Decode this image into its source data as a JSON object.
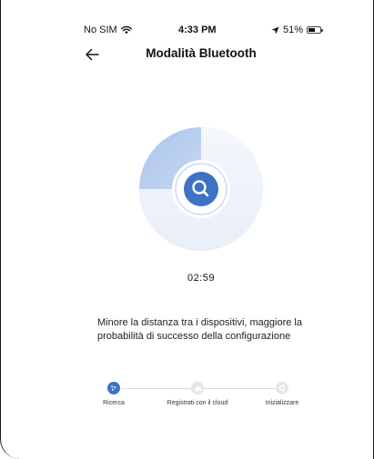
{
  "status_bar": {
    "carrier": "No SIM",
    "time": "4:33 PM",
    "battery": "51%"
  },
  "header": {
    "title": "Modalità Bluetooth"
  },
  "scan": {
    "timer": "02:59",
    "progress_fraction": 0.25
  },
  "hint": "Minore la distanza tra i dispositivi, maggiore la probabilità di successo della configurazione",
  "steps": [
    {
      "label": "Ricerca",
      "state": "active"
    },
    {
      "label": "Registrati con il cloud",
      "state": "inactive"
    },
    {
      "label": "Inizializzare",
      "state": "inactive"
    }
  ],
  "colors": {
    "accent": "#3d72c4",
    "ring_light": "#dbe6f5",
    "inactive_step": "#e4e6ea"
  },
  "icons": [
    "wifi-icon",
    "location-arrow-icon",
    "battery-icon",
    "back-arrow-icon",
    "search-icon"
  ]
}
